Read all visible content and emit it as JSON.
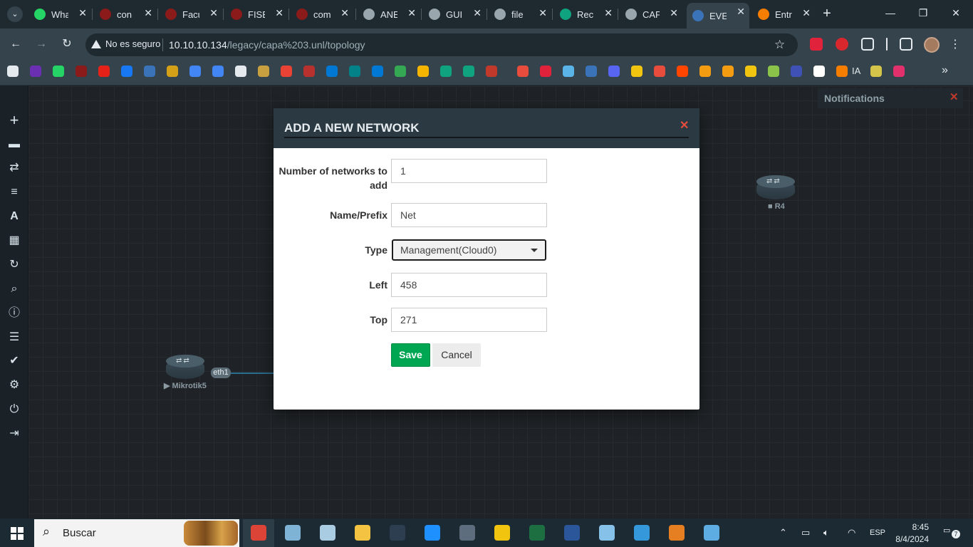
{
  "browser": {
    "tabs": [
      {
        "label": "Wha",
        "icon": "whatsapp-icon",
        "color": "#25d366"
      },
      {
        "label": "con",
        "icon": "shield-icon",
        "color": "#8b1a1a"
      },
      {
        "label": "Facu",
        "icon": "shield-icon",
        "color": "#8b1a1a"
      },
      {
        "label": "FISE",
        "icon": "shield-icon",
        "color": "#8b1a1a"
      },
      {
        "label": "com",
        "icon": "shield-icon",
        "color": "#8b1a1a"
      },
      {
        "label": "ANE",
        "icon": "globe-icon",
        "color": "#9aa6ad"
      },
      {
        "label": "GUI",
        "icon": "globe-icon",
        "color": "#9aa6ad"
      },
      {
        "label": "file",
        "icon": "globe-icon",
        "color": "#9aa6ad"
      },
      {
        "label": "Rec",
        "icon": "openai-icon",
        "color": "#10a37f"
      },
      {
        "label": "CAP",
        "icon": "globe-icon",
        "color": "#9aa6ad"
      },
      {
        "label": "EVE",
        "icon": "eve-icon",
        "color": "#3b73b9",
        "active": true
      },
      {
        "label": "Entr",
        "icon": "blogger-icon",
        "color": "#f57d00"
      }
    ],
    "security_label": "No es seguro",
    "url_host": "10.10.10.134",
    "url_path": "/legacy/capa%203.unl/topology",
    "bookmarks_text": "IA"
  },
  "workspace": {
    "notifications_title": "Notifications",
    "nodes": [
      {
        "label": "Mikrotik5",
        "status": "stopped"
      },
      {
        "label": "R4",
        "status": "stopped"
      }
    ],
    "interface_label": "eth1"
  },
  "modal": {
    "title": "ADD A NEW NETWORK",
    "fields": {
      "count_label": "Number of networks to add",
      "count_value": "1",
      "name_label": "Name/Prefix",
      "name_value": "Net",
      "type_label": "Type",
      "type_value": "Management(Cloud0)",
      "left_label": "Left",
      "left_value": "458",
      "top_label": "Top",
      "top_value": "271"
    },
    "save_label": "Save",
    "cancel_label": "Cancel"
  },
  "taskbar": {
    "search_text": "Buscar",
    "language": "ESP",
    "time": "8:45",
    "date": "8/4/2024",
    "notification_count": "7"
  },
  "colors": {
    "save_green": "#00a651",
    "close_red": "#e74c3c",
    "modal_header": "#2b3a42"
  }
}
